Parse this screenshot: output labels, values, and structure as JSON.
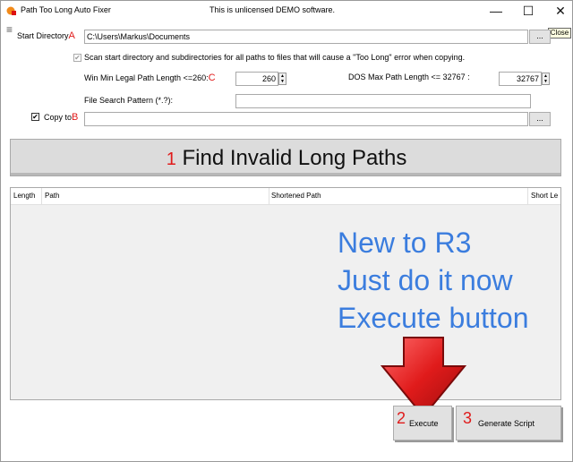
{
  "window": {
    "title": "Path Too Long Auto Fixer",
    "center_text": "This is unlicensed DEMO software.",
    "close_tooltip": "Close",
    "controls": {
      "minimize": "—",
      "maximize": "☐",
      "close": "✕"
    }
  },
  "menu_icon": "≡",
  "start_directory": {
    "label": "Start Directory",
    "marker": "A",
    "value": "C:\\Users\\Markus\\Documents",
    "browse_label": "..."
  },
  "scan_option": {
    "checked_glyph": "✔",
    "label": "Scan start directory and subdirectories for all paths to files that will cause a \"Too Long\" error when copying."
  },
  "win_min": {
    "label": "Win Min Legal Path Length <=260:",
    "marker": "C",
    "value": "260"
  },
  "dos_max": {
    "label": "DOS Max Path Length <= 32767 :",
    "value": "32767"
  },
  "file_search": {
    "label": "File Search Pattern (*.?):",
    "value": ""
  },
  "copy_to": {
    "checked_glyph": "✔",
    "label": "Copy to",
    "marker": "B",
    "value": "",
    "browse_label": "..."
  },
  "find_button": {
    "number": "1",
    "label": "Find Invalid Long Paths"
  },
  "results_table": {
    "columns": [
      "Length",
      "Path",
      "Shortened Path",
      "Short Le"
    ]
  },
  "annotation": {
    "lines": [
      "New to R3",
      "Just do it now",
      "Execute button"
    ],
    "arrow_color": "#e01b1b"
  },
  "execute_button": {
    "number": "2",
    "label": "Execute"
  },
  "generate_button": {
    "number": "3",
    "label": "Generate Script"
  }
}
